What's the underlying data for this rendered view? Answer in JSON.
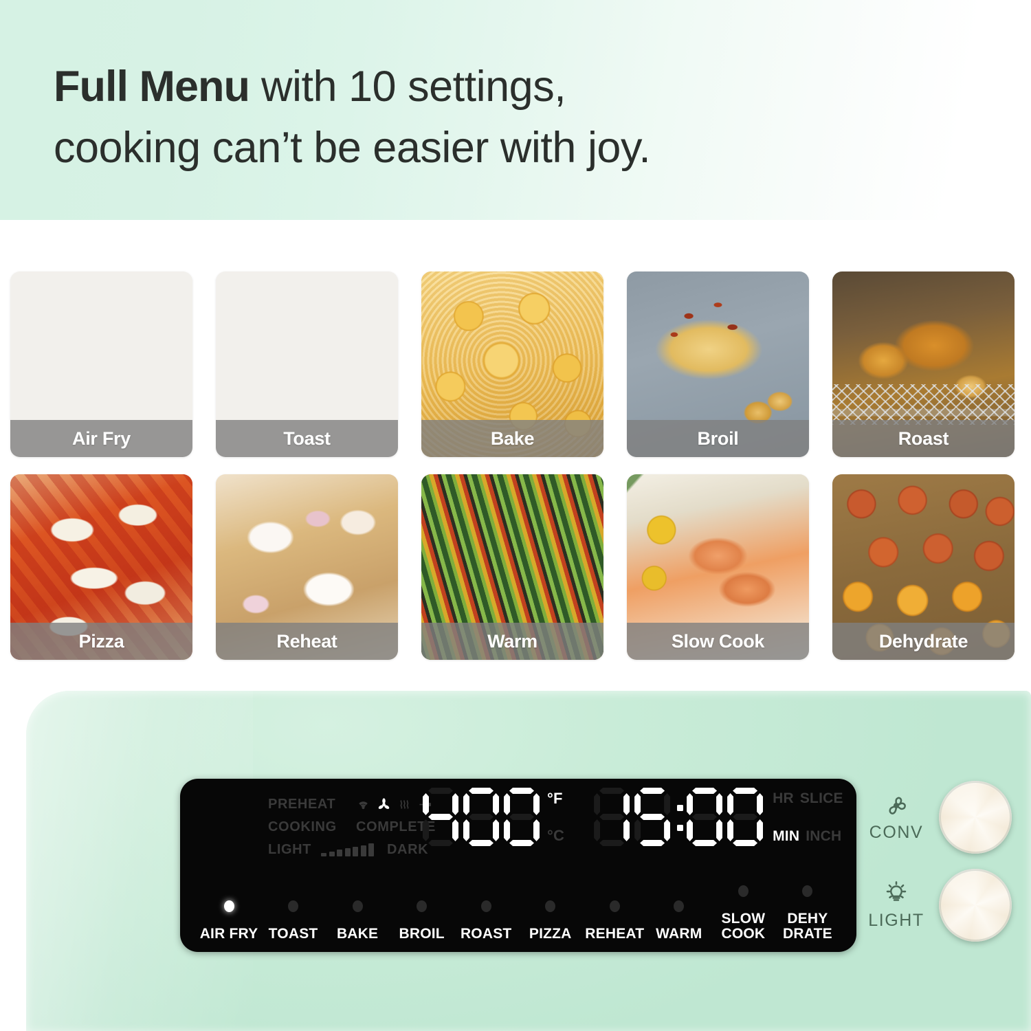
{
  "header": {
    "headline_strong": "Full Menu",
    "headline_rest": " with 10 settings,\ncooking can’t be easier with joy."
  },
  "menu_tiles": [
    {
      "label": "Air Fry",
      "photo": "french-fries-with-ketchup"
    },
    {
      "label": "Toast",
      "photo": "two-slices-golden-toast"
    },
    {
      "label": "Bake",
      "photo": "butter-cookies-pile"
    },
    {
      "label": "Broil",
      "photo": "broiled-chicken-breast-with-potatoes"
    },
    {
      "label": "Roast",
      "photo": "roast-whole-chicken-on-rack"
    },
    {
      "label": "Pizza",
      "photo": "margherita-pizza-closeup"
    },
    {
      "label": "Reheat",
      "photo": "creamy-loaded-potatoes"
    },
    {
      "label": "Warm",
      "photo": "vegetable-ratatouille-in-dish"
    },
    {
      "label": "Slow Cook",
      "photo": "salmon-fillets-with-lemon"
    },
    {
      "label": "Dehydrate",
      "photo": "dried-citrus-slices-tray"
    }
  ],
  "oven": {
    "body_color": "#c9ecd8",
    "panel_color": "#070707",
    "display": {
      "status_labels": {
        "preheat": "PREHEAT",
        "cooking": "COOKING",
        "complete": "COMPLETE",
        "light": "LIGHT",
        "dark": "DARK"
      },
      "status_icons": [
        {
          "name": "wifi-icon",
          "state": "dim"
        },
        {
          "name": "fan-icon",
          "state": "lit"
        },
        {
          "name": "heat-waves-icon",
          "state": "dim"
        },
        {
          "name": "rotisserie-icon",
          "state": "dim"
        }
      ],
      "doneness_bars": 7,
      "temperature": {
        "value": "400",
        "digits": [
          "4",
          "0",
          "0"
        ],
        "unit_active": "°F",
        "unit_inactive": "°C"
      },
      "timer": {
        "value": "15:00",
        "digits": [
          "1",
          "5",
          "0",
          "0"
        ],
        "unit_hr": "HR",
        "unit_slice": "SLICE",
        "unit_min": "MIN",
        "unit_inch": "INCH",
        "active_unit": "MIN"
      }
    },
    "modes": [
      {
        "label": "AIR FRY",
        "active": true
      },
      {
        "label": "TOAST",
        "active": false
      },
      {
        "label": "BAKE",
        "active": false
      },
      {
        "label": "BROIL",
        "active": false
      },
      {
        "label": "ROAST",
        "active": false
      },
      {
        "label": "PIZZA",
        "active": false
      },
      {
        "label": "REHEAT",
        "active": false
      },
      {
        "label": "WARM",
        "active": false
      },
      {
        "label": "SLOW\nCOOK",
        "active": false
      },
      {
        "label": "DEHY\nDRATE",
        "active": false
      }
    ],
    "knobs": [
      {
        "label": "CONV",
        "icon": "fan-icon"
      },
      {
        "label": "LIGHT",
        "icon": "light-bulb-icon"
      }
    ]
  }
}
